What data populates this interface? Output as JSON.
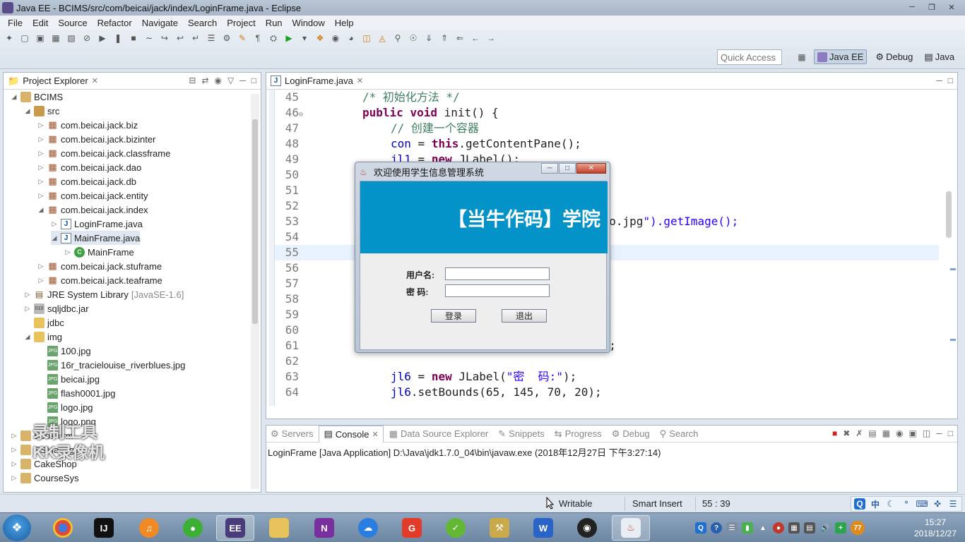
{
  "window": {
    "title": "Java EE - BCIMS/src/com/beicai/jack/index/LoginFrame.java - Eclipse"
  },
  "menu": [
    "File",
    "Edit",
    "Source",
    "Refactor",
    "Navigate",
    "Search",
    "Project",
    "Run",
    "Window",
    "Help"
  ],
  "toolbar": {
    "quick_access_placeholder": "Quick Access",
    "perspectives": [
      {
        "label": "Java EE",
        "active": true
      },
      {
        "label": "Debug",
        "active": false
      },
      {
        "label": "Java",
        "active": false
      }
    ]
  },
  "explorer": {
    "tab_label": "Project Explorer",
    "nodes": [
      {
        "label": "BCIMS",
        "icon": "project-icon",
        "twisty": "expanded"
      },
      {
        "label": "src",
        "icon": "source-folder-icon",
        "twisty": "expanded"
      },
      {
        "label": "com.beicai.jack.biz",
        "icon": "package-icon",
        "twisty": "collapsed"
      },
      {
        "label": "com.beicai.jack.bizinter",
        "icon": "package-icon",
        "twisty": "collapsed"
      },
      {
        "label": "com.beicai.jack.classframe",
        "icon": "package-icon",
        "twisty": "collapsed"
      },
      {
        "label": "com.beicai.jack.dao",
        "icon": "package-icon",
        "twisty": "collapsed"
      },
      {
        "label": "com.beicai.jack.db",
        "icon": "package-icon",
        "twisty": "collapsed"
      },
      {
        "label": "com.beicai.jack.entity",
        "icon": "package-icon",
        "twisty": "collapsed"
      },
      {
        "label": "com.beicai.jack.index",
        "icon": "package-icon",
        "twisty": "expanded"
      },
      {
        "label": "LoginFrame.java",
        "icon": "java-file-icon",
        "twisty": "collapsed"
      },
      {
        "label": "MainFrame.java",
        "icon": "java-file-icon",
        "twisty": "expanded"
      },
      {
        "label": "MainFrame",
        "icon": "class-icon",
        "twisty": "collapsed"
      },
      {
        "label": "com.beicai.jack.stuframe",
        "icon": "package-icon",
        "twisty": "collapsed"
      },
      {
        "label": "com.beicai.jack.teaframe",
        "icon": "package-icon",
        "twisty": "collapsed"
      },
      {
        "label": "JRE System Library",
        "decoration": "[JavaSE-1.6]",
        "icon": "library-icon",
        "twisty": "collapsed"
      },
      {
        "label": "sqljdbc.jar",
        "icon": "jar-icon",
        "twisty": "collapsed"
      },
      {
        "label": "jdbc",
        "icon": "folder-icon",
        "twisty": "none"
      },
      {
        "label": "img",
        "icon": "folder-icon",
        "twisty": "expanded"
      },
      {
        "label": "100.jpg",
        "icon": "image-file-icon",
        "twisty": "none"
      },
      {
        "label": "16r_tracielouise_riverblues.jpg",
        "icon": "image-file-icon",
        "twisty": "none"
      },
      {
        "label": "beicai.jpg",
        "icon": "image-file-icon",
        "twisty": "none"
      },
      {
        "label": "flash0001.jpg",
        "icon": "image-file-icon",
        "twisty": "none"
      },
      {
        "label": "logo.jpg",
        "icon": "image-file-icon",
        "twisty": "none"
      },
      {
        "label": "logo.png",
        "icon": "image-file-icon",
        "twisty": "none"
      },
      {
        "label": "Book-crm",
        "icon": "project-icon",
        "twisty": "collapsed"
      },
      {
        "label": "ESManage",
        "icon": "project-icon",
        "twisty": "collapsed"
      },
      {
        "label": "CakeShop",
        "icon": "project-icon",
        "twisty": "collapsed"
      },
      {
        "label": "CourseSys",
        "icon": "project-icon",
        "twisty": "collapsed"
      }
    ]
  },
  "watermark": {
    "line1": "录制工具",
    "line2": "KK录像机"
  },
  "editor": {
    "tab_label": "LoginFrame.java",
    "lines": [
      {
        "num": "45",
        "code": "/* 初始化方法 */"
      },
      {
        "num": "46",
        "code": "public void init() {"
      },
      {
        "num": "47",
        "code": "// 创建一个容器"
      },
      {
        "num": "48",
        "code": "con = this.getContentPane();"
      },
      {
        "num": "49",
        "code": "jl1 = new JLabel();"
      },
      {
        "num": "50",
        "code": ""
      },
      {
        "num": "51",
        "code": ""
      },
      {
        "num": "52",
        "code": ""
      },
      {
        "num": "53",
        "code": "ogo.jpg\").getImage();"
      },
      {
        "num": "54",
        "code": ""
      },
      {
        "num": "55",
        "code": ""
      },
      {
        "num": "56",
        "code": ""
      },
      {
        "num": "57",
        "code": ""
      },
      {
        "num": "58",
        "code": ""
      },
      {
        "num": "59",
        "code": ""
      },
      {
        "num": "60",
        "code": ""
      },
      {
        "num": "61",
        "code": "0);"
      },
      {
        "num": "62",
        "code": ""
      },
      {
        "num": "63",
        "code": "jl6 = new JLabel(\"密  码:\");"
      },
      {
        "num": "64",
        "code": "jl6.setBounds(65, 145, 70, 20);"
      }
    ]
  },
  "login_dialog": {
    "title": "欢迎使用学生信息管理系统",
    "banner": "【当牛作码】学院",
    "username_label": "用户名:",
    "password_label": "密  码:",
    "login_button": "登录",
    "exit_button": "退出"
  },
  "console": {
    "tabs": [
      "Servers",
      "Console",
      "Data Source Explorer",
      "Snippets",
      "Progress",
      "Debug",
      "Search"
    ],
    "active_tab": "Console",
    "description": "LoginFrame [Java Application] D:\\Java\\jdk1.7.0_04\\bin\\javaw.exe (2018年12月27日 下午3:27:14)"
  },
  "statusbar": {
    "writable": "Writable",
    "insert_mode": "Smart Insert",
    "position": "55 : 39",
    "ime": [
      "中"
    ]
  },
  "taskbar": {
    "clock_time": "15:27",
    "clock_date": "2018/12/27",
    "tray_badge": "77"
  }
}
